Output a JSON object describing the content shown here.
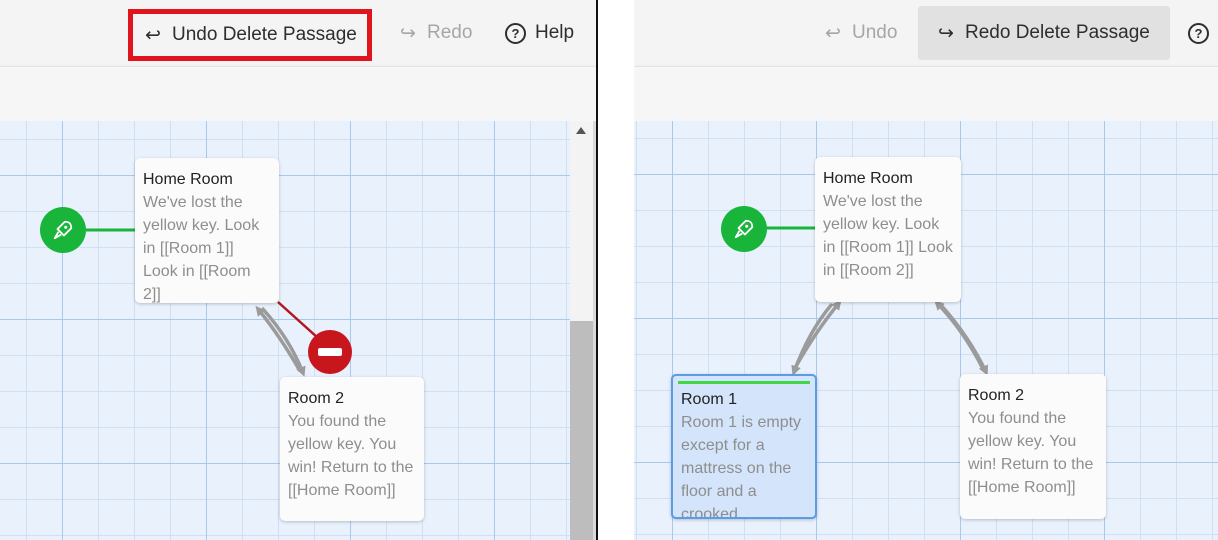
{
  "left": {
    "toolbar": {
      "undo_label": "Undo Delete Passage",
      "redo_label": "Redo",
      "help_label": "Help"
    },
    "passages": [
      {
        "title": "Home Room",
        "excerpt": "We've lost the yellow key. Look in [[Room 1]] Look in [[Room 2]]"
      },
      {
        "title": "Room 2",
        "excerpt": "You found the yellow key. You win! Return to the [[Home Room]]"
      }
    ]
  },
  "right": {
    "toolbar": {
      "undo_label": "Undo",
      "redo_label": "Redo Delete Passage"
    },
    "passages": [
      {
        "title": "Home Room",
        "excerpt": "We've lost the yellow key. Look in [[Room 1]] Look in [[Room 2]]"
      },
      {
        "title": "Room 1",
        "excerpt": "Room 1 is empty except for a mattress on the floor and a crooked"
      },
      {
        "title": "Room 2",
        "excerpt": "You found the yellow key. You win! Return to the [[Home Room]]"
      }
    ]
  },
  "icons": {
    "undo": "undo-arrow-icon",
    "redo": "redo-arrow-icon",
    "help": "help-circle-icon",
    "start": "rocket-icon",
    "delete": "minus-circle-icon"
  },
  "colors": {
    "highlight": "#e0141c",
    "start_node": "#19b53a",
    "delete_node": "#c8161d",
    "selected_border": "#5b9be8",
    "selected_marker": "#3fd648",
    "grid_background": "#e8f1fc"
  }
}
